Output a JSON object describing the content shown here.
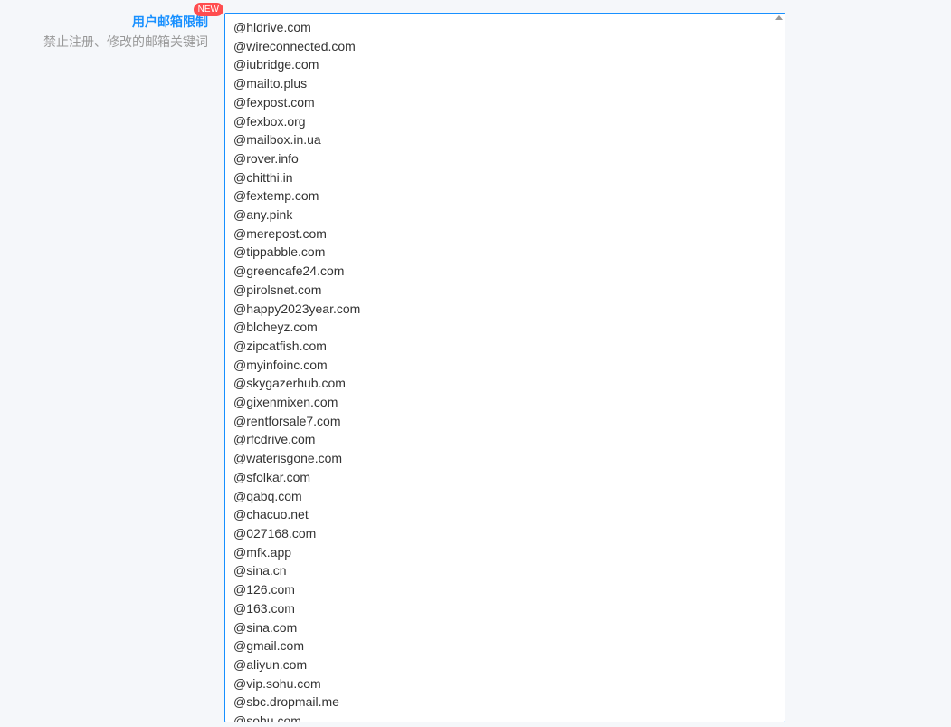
{
  "label": {
    "title": "用户邮箱限制",
    "badge": "NEW",
    "subtitle": "禁止注册、修改的邮箱关键词"
  },
  "emailRestrictions": {
    "value": "@hldrive.com\n@wireconnected.com\n@iubridge.com\n@mailto.plus\n@fexpost.com\n@fexbox.org\n@mailbox.in.ua\n@rover.info\n@chitthi.in\n@fextemp.com\n@any.pink\n@merepost.com\n@tippabble.com\n@greencafe24.com\n@pirolsnet.com\n@happy2023year.com\n@bloheyz.com\n@zipcatfish.com\n@myinfoinc.com\n@skygazerhub.com\n@gixenmixen.com\n@rentforsale7.com\n@rfcdrive.com\n@waterisgone.com\n@sfolkar.com\n@qabq.com\n@chacuo.net\n@027168.com\n@mfk.app\n@sina.cn\n@126.com\n@163.com\n@sina.com\n@gmail.com\n@aliyun.com\n@vip.sohu.com\n@sbc.dropmail.me\n@sohu.com\n"
  }
}
